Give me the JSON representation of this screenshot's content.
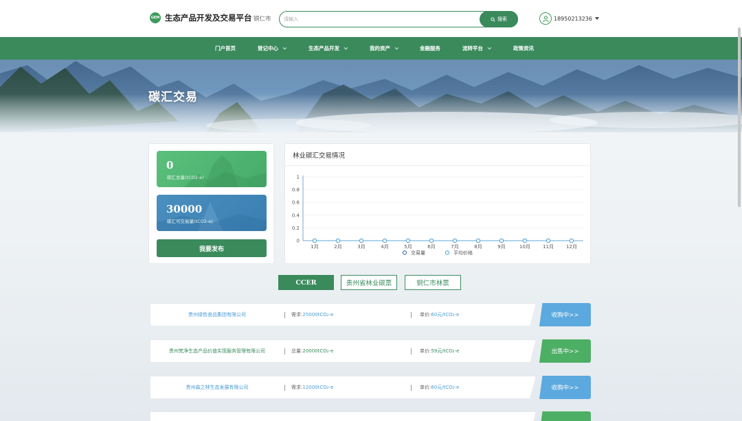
{
  "header": {
    "logo_mark": "GEM",
    "title": "生态产品开发及交易平台",
    "city": "铜仁市",
    "search_placeholder": "请输入",
    "search_button": "搜索",
    "user_phone": "18950213236"
  },
  "nav": {
    "items": [
      {
        "label": "门户首页",
        "dropdown": false
      },
      {
        "label": "登记中心",
        "dropdown": true
      },
      {
        "label": "生态产品开发",
        "dropdown": true
      },
      {
        "label": "我的资产",
        "dropdown": true
      },
      {
        "label": "金融服务",
        "dropdown": false
      },
      {
        "label": "流转平台",
        "dropdown": true
      },
      {
        "label": "政策资讯",
        "dropdown": false
      }
    ]
  },
  "banner": {
    "title": "碳汇交易"
  },
  "stats": {
    "total_value": "0",
    "total_label": "碳汇总量(tCO2-e)",
    "tradable_value": "30000",
    "tradable_label": "碳汇可交易量(tCO2-e)",
    "publish_button": "我要发布"
  },
  "chart": {
    "title": "林业碳汇交易情况"
  },
  "chart_data": {
    "type": "line",
    "title": "林业碳汇交易情况",
    "categories": [
      "1月",
      "2月",
      "3月",
      "4月",
      "5月",
      "6月",
      "7月",
      "8月",
      "9月",
      "10月",
      "11月",
      "12月"
    ],
    "series": [
      {
        "name": "交易量",
        "values": [
          0,
          0,
          0,
          0,
          0,
          0,
          0,
          0,
          0,
          0,
          0,
          0
        ],
        "color": "#3d6fa8"
      },
      {
        "name": "平均价格",
        "values": [
          0,
          0,
          0,
          0,
          0,
          0,
          0,
          0,
          0,
          0,
          0,
          0
        ],
        "color": "#5ba9de"
      }
    ],
    "yticks": [
      "0",
      "0.2",
      "0.4",
      "0.6",
      "0.8",
      "1"
    ],
    "ylim": [
      0,
      1
    ],
    "legend": "bottom",
    "grid": true
  },
  "tabs": [
    {
      "label": "CCER",
      "active": true
    },
    {
      "label": "贵州省林业碳票",
      "active": false
    },
    {
      "label": "铜仁市林票",
      "active": false
    }
  ],
  "listings": [
    {
      "company": "贵州绿色食品集团有限公司",
      "qty_label": "需求:",
      "qty_value": "25000tCO₂-e",
      "price_label": "单价:",
      "price_value": "60元/tCO₂-e",
      "action": "收购中>>",
      "kind": "buy"
    },
    {
      "company": "贵州梵净生态产品价值实现服务管理有限公司",
      "qty_label": "总量:",
      "qty_value": "20000tCO₂-e",
      "price_label": "单价:",
      "price_value": "59元/tCO₂-e",
      "action": "出售中>>",
      "kind": "sell"
    },
    {
      "company": "贵州森之林生态发展有限公司",
      "qty_label": "需求:",
      "qty_value": "12000tCO₂-e",
      "price_label": "单价:",
      "price_value": "60元/tCO₂-e",
      "action": "收购中>>",
      "kind": "buy"
    }
  ],
  "colors": {
    "primary": "#3a8a5c",
    "buy": "#5ba9de",
    "sell": "#4caf64"
  }
}
